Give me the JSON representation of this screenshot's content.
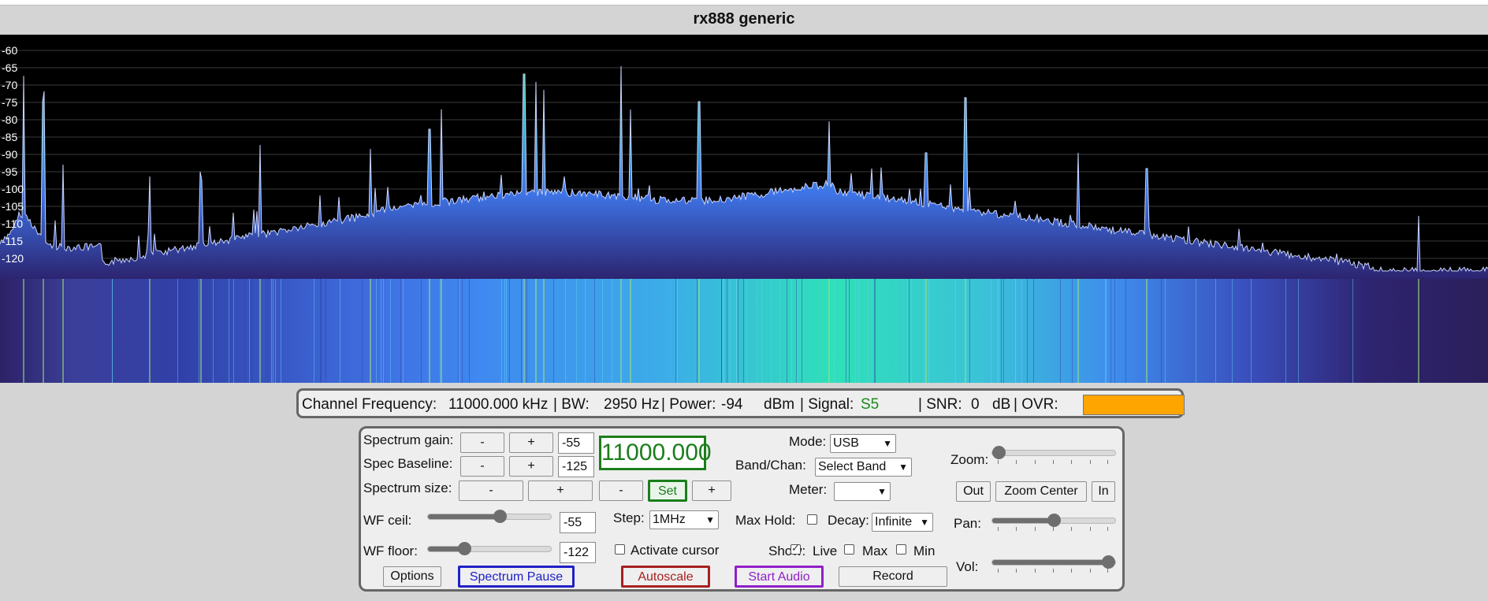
{
  "app": {
    "title": "rx888 generic"
  },
  "spectrum": {
    "y_labels": [
      "-60",
      "-65",
      "-70",
      "-75",
      "-80",
      "-85",
      "-90",
      "-95",
      "-100",
      "-105",
      "-110",
      "-115",
      "-120"
    ],
    "colors": {
      "background": "#000000",
      "grid": "#3a3a3a",
      "trace": "#c9d3ff"
    }
  },
  "status": {
    "channel_label": "Channel Frequency:",
    "channel_value": "11000.000 kHz",
    "bw_label": "| BW:",
    "bw_value": "2950 Hz",
    "power_label": "| Power:",
    "power_value": "-94",
    "power_unit": "dBm",
    "signal_label": "| Signal:",
    "signal_value": "S5",
    "snr_label": "| SNR:",
    "snr_value": "0",
    "snr_unit": "dB",
    "ovr_label": "| OVR:",
    "ovr_color": "#ffa500",
    "signal_color": "#1b8a1b"
  },
  "controls": {
    "spectrum_gain_label": "Spectrum gain:",
    "spectrum_gain_value": "-55",
    "spec_baseline_label": "Spec Baseline:",
    "spec_baseline_value": "-125",
    "spectrum_size_label": "Spectrum size:",
    "minus": "-",
    "plus": "+",
    "frequency": "11000.000",
    "set_label": "Set",
    "wf_ceil_label": "WF ceil:",
    "wf_ceil_value": "-55",
    "wf_ceil_fraction": 0.6,
    "wf_floor_label": "WF floor:",
    "wf_floor_value": "-122",
    "wf_floor_fraction": 0.27,
    "step_label": "Step:",
    "step_value": "1MHz",
    "activate_cursor_label": "Activate cursor",
    "activate_cursor_checked": false,
    "mode_label": "Mode:",
    "mode_value": "USB",
    "band_label": "Band/Chan:",
    "band_value": "Select Band",
    "meter_label": "Meter:",
    "meter_value": "",
    "max_hold_label": "Max Hold:",
    "max_hold_checked": false,
    "decay_label": "Decay:",
    "decay_value": "Infinite",
    "show_label": "Show:",
    "live_label": "Live",
    "live_checked": true,
    "max_label": "Max",
    "max_checked": false,
    "min_label": "Min",
    "min_checked": false,
    "zoom_label": "Zoom:",
    "zoom_fraction": 0.0,
    "zoom_out_label": "Out",
    "zoom_center_label": "Zoom Center",
    "zoom_in_label": "In",
    "pan_label": "Pan:",
    "pan_fraction": 0.5,
    "vol_label": "Vol:",
    "vol_fraction": 1.0,
    "options_label": "Options",
    "spectrum_pause_label": "Spectrum Pause",
    "autoscale_label": "Autoscale",
    "start_audio_label": "Start Audio",
    "record_label": "Record"
  }
}
